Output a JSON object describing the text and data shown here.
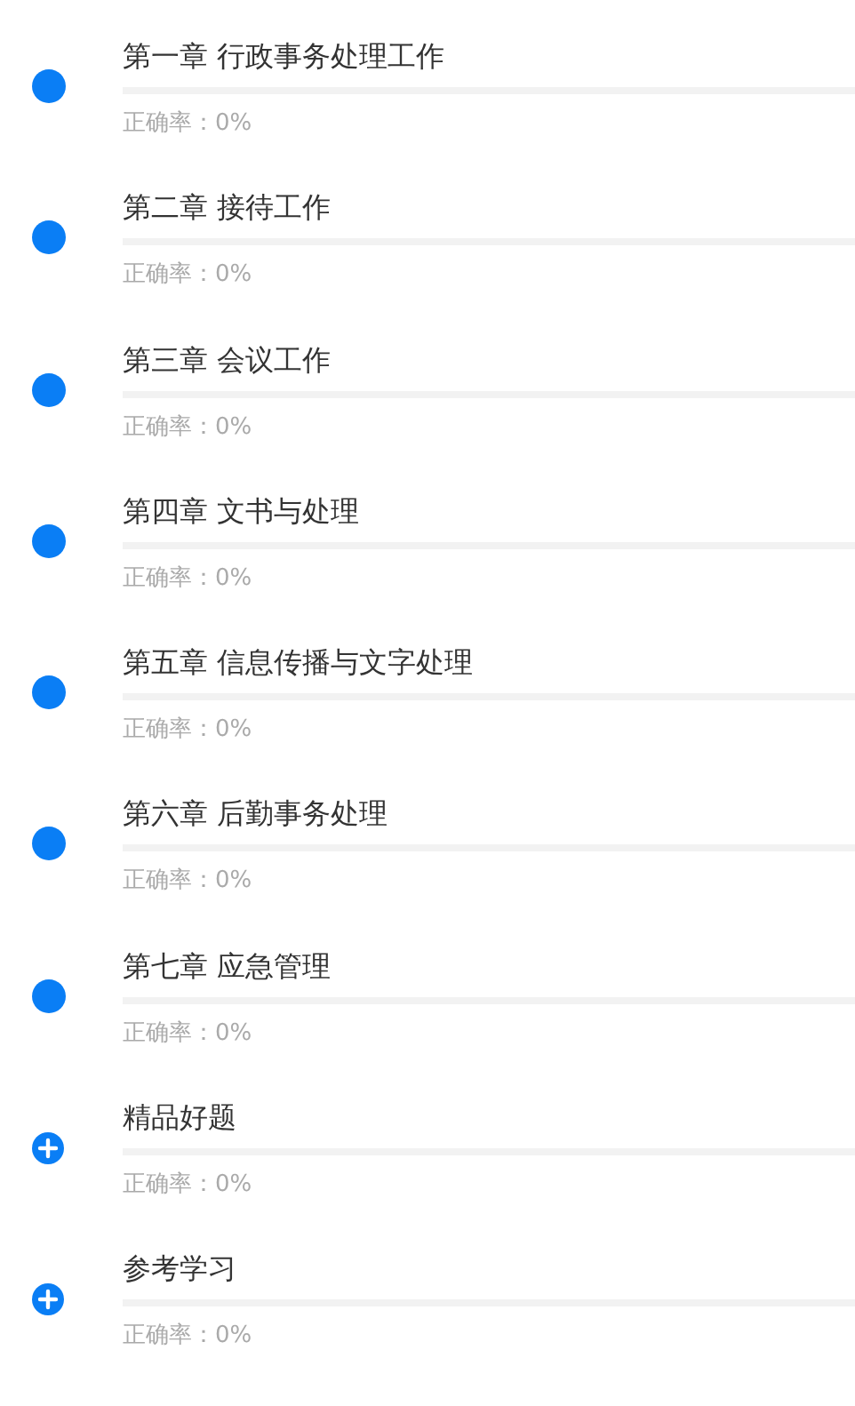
{
  "chapters": [
    {
      "kind": "dot",
      "title": "第一章 行政事务处理工作",
      "level": 0,
      "accuracy": "正确率：0%"
    },
    {
      "kind": "dot",
      "title": "第二章 接待工作",
      "level": 0,
      "accuracy": "正确率：0%"
    },
    {
      "kind": "dot",
      "title": "第三章 会议工作",
      "level": 0,
      "accuracy": "正确率：0%"
    },
    {
      "kind": "dot",
      "title": "第四章 文书与处理",
      "level": 0,
      "accuracy": "正确率：0%"
    },
    {
      "kind": "dot",
      "title": "第五章 信息传播与文字处理",
      "level": 0,
      "accuracy": "正确率：0%"
    },
    {
      "kind": "dot",
      "title": "第六章 后勤事务处理",
      "level": 0,
      "accuracy": "正确率：0%"
    },
    {
      "kind": "dot",
      "title": "第七章 应急管理",
      "level": 0,
      "accuracy": "正确率：0%"
    },
    {
      "kind": "plus",
      "title": "精品好题",
      "level": 0,
      "accuracy": "正确率：0%"
    },
    {
      "kind": "plus",
      "title": "参考学习",
      "level": 0,
      "accuracy": "正确率：0%"
    }
  ]
}
